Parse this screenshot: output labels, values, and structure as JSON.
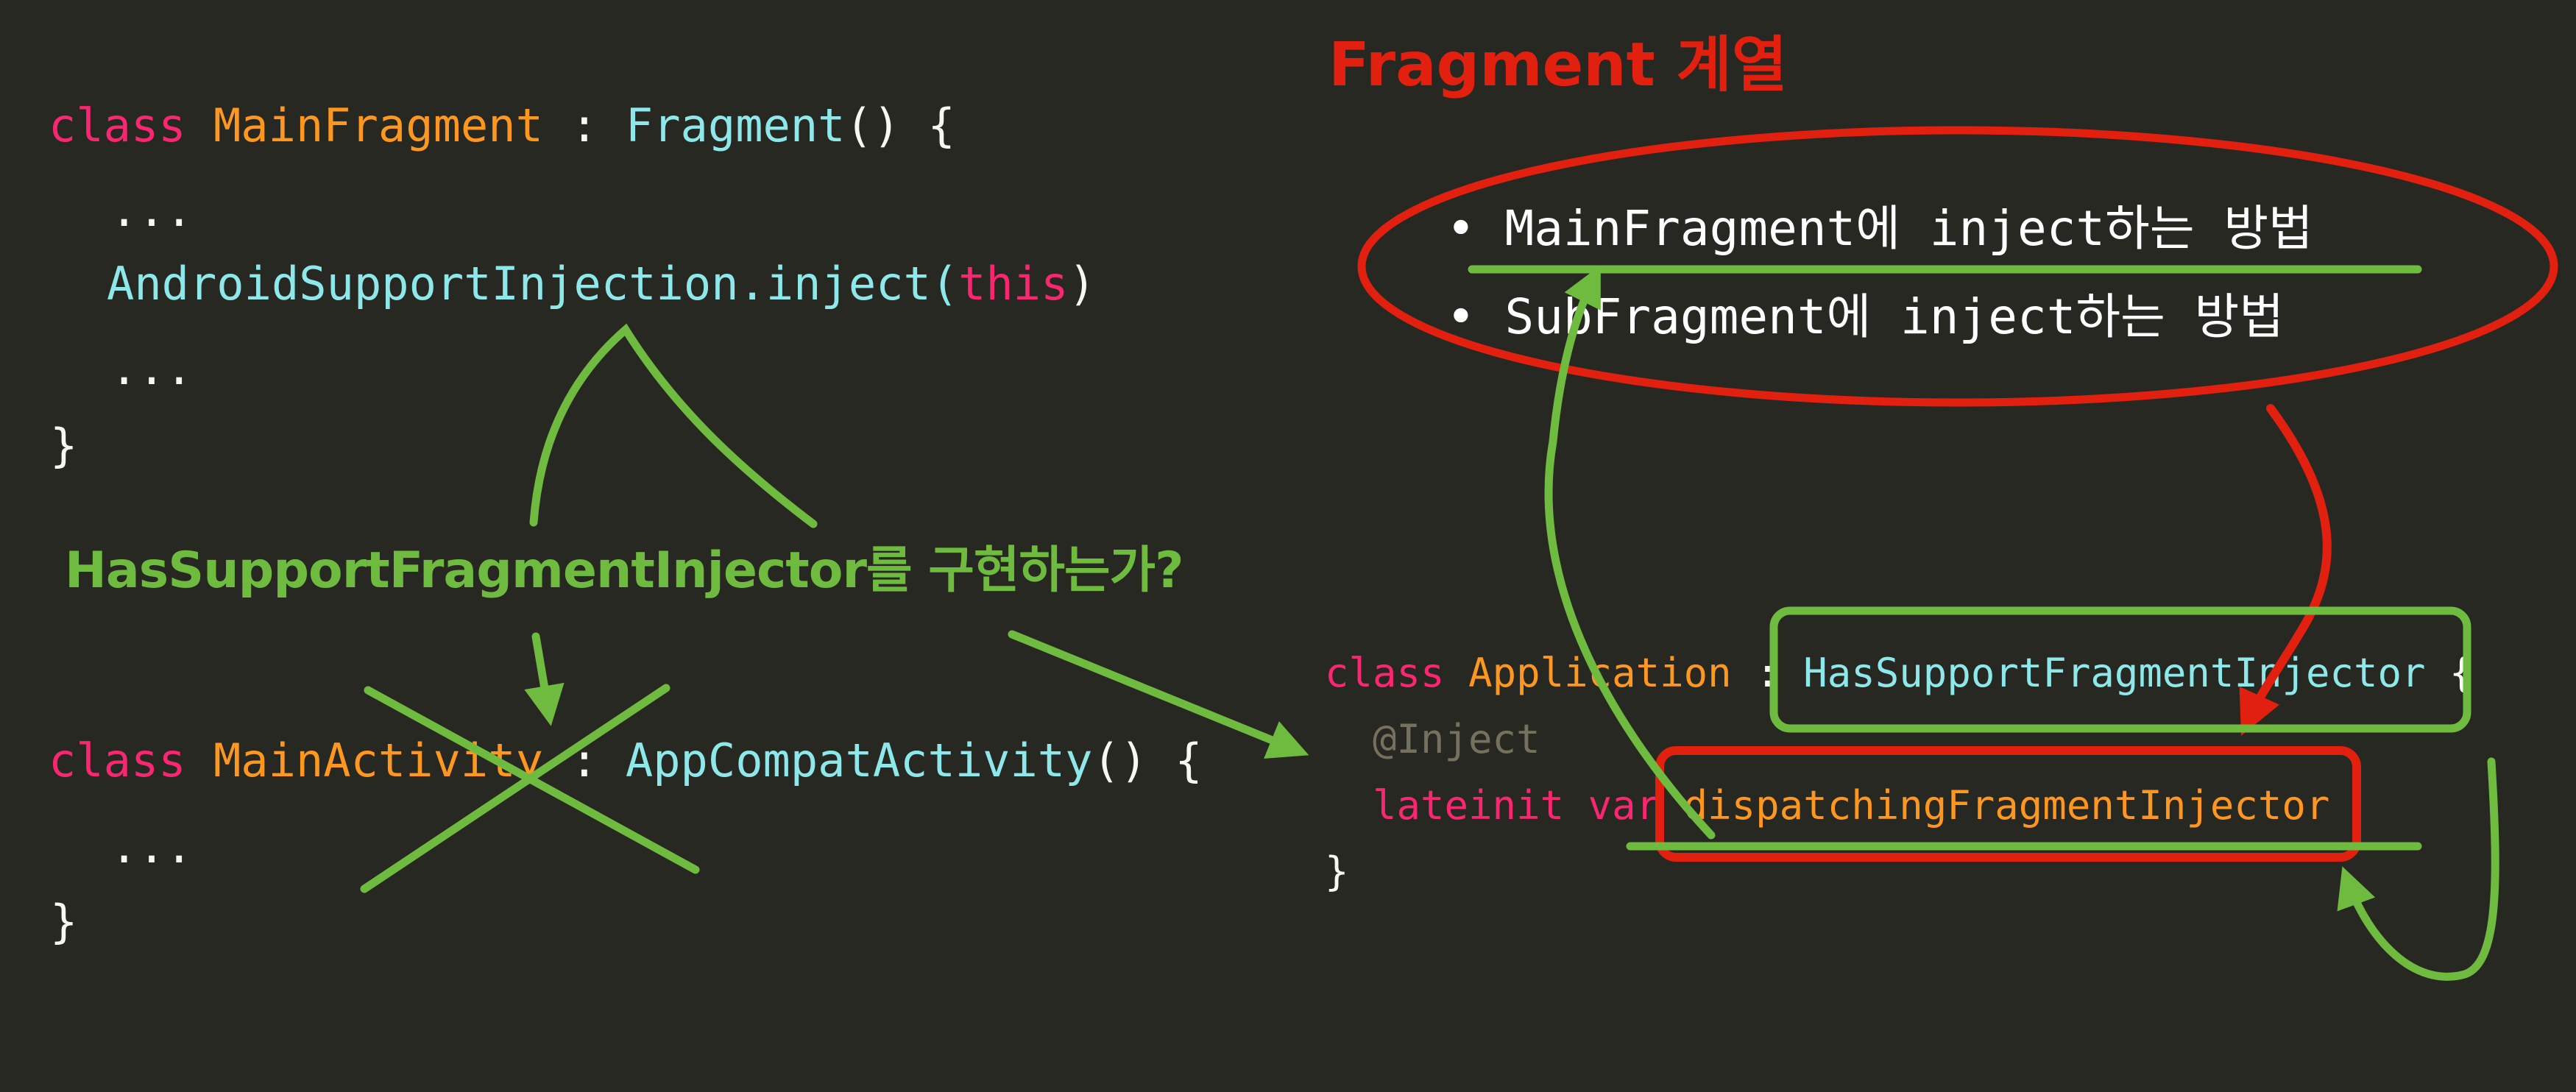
{
  "title": "Fragment 계열",
  "question": "HasSupportFragmentInjector를 구현하는가?",
  "bullets": [
    "• MainFragment에 inject하는 방법",
    "• SubFragment에 inject하는 방법"
  ],
  "main_fragment_code": {
    "l1_kw": "class ",
    "l1_name": "MainFragment",
    "l1_sep": " : ",
    "l1_super": "Fragment",
    "l1_end": "() {",
    "l2": "...",
    "l3_obj": "AndroidSupportInjection.inject(",
    "l3_arg": "this",
    "l3_end": ")",
    "l4": "...",
    "l5": "}"
  },
  "main_activity_code": {
    "l1_kw": "class ",
    "l1_name": "MainActivity",
    "l1_sep": " : ",
    "l1_super": "AppCompatActivity",
    "l1_end": "() {",
    "l2": "...",
    "l3": "}"
  },
  "application_code": {
    "l1_kw": "class ",
    "l1_name": "Application",
    "l1_sep": " : ",
    "l1_iface": "HasSupportFragmentInjector",
    "l1_end": " {",
    "l2": "@Inject",
    "l3_kw": "lateinit var ",
    "l3_name": "dispatchingFragmentInjector",
    "l4": "}"
  },
  "colors": {
    "background": "#272822",
    "annotation_green": "#6ebb3f",
    "annotation_red": "#e2200f",
    "keyword": "#f92672",
    "type_name": "#fd971f",
    "class_ref": "#8ee8ea"
  }
}
